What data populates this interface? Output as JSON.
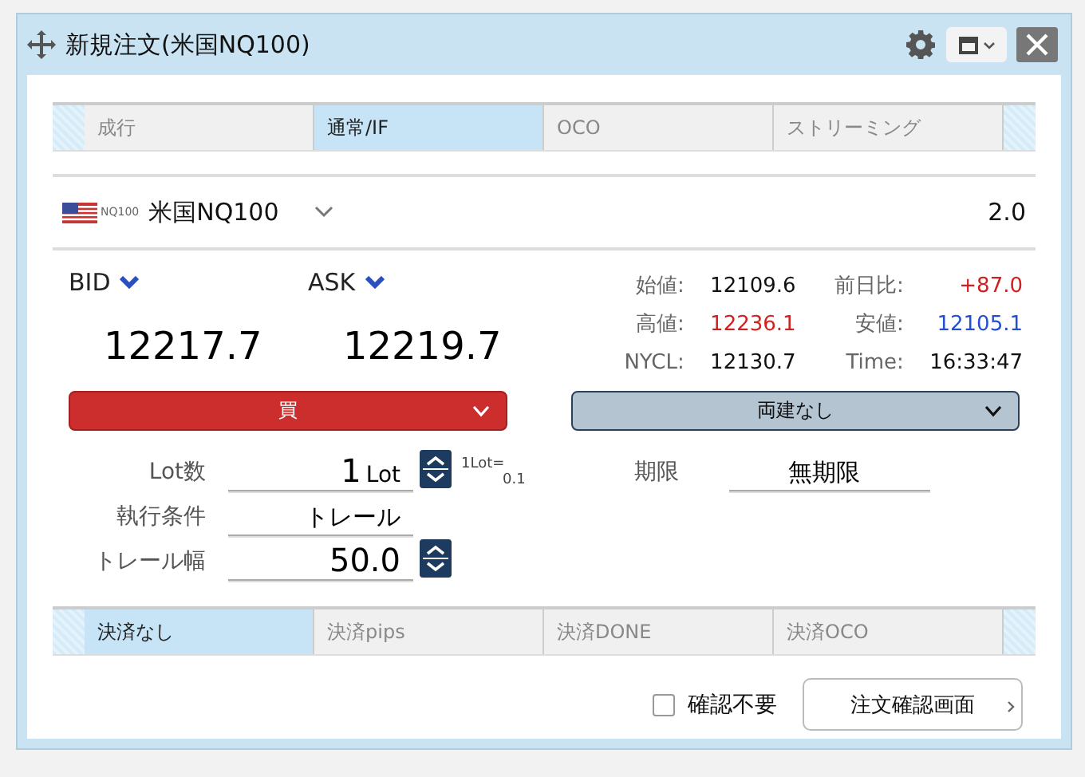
{
  "window": {
    "title": "新規注文(米国NQ100)"
  },
  "order_tabs": [
    {
      "label": "成行",
      "selected": false
    },
    {
      "label": "通常/IF",
      "selected": true
    },
    {
      "label": "OCO",
      "selected": false
    },
    {
      "label": "ストリーミング",
      "selected": false
    }
  ],
  "symbol": {
    "code": "NQ100",
    "name": "米国NQ100",
    "value": "2.0"
  },
  "bid": {
    "label": "BID",
    "price": "12217.7"
  },
  "ask": {
    "label": "ASK",
    "price": "12219.7"
  },
  "stats": [
    {
      "label": "始値:",
      "value": "12109.6",
      "color": "#111111"
    },
    {
      "label": "前日比:",
      "value": "+87.0",
      "color": "#d02020"
    },
    {
      "label": "高値:",
      "value": "12236.1",
      "color": "#d02020"
    },
    {
      "label": "安値:",
      "value": "12105.1",
      "color": "#2050d0"
    },
    {
      "label": "NYCL:",
      "value": "12130.7",
      "color": "#111111"
    },
    {
      "label": "Time:",
      "value": "16:33:47",
      "color": "#111111"
    }
  ],
  "side": {
    "value": "買"
  },
  "hedge": {
    "value": "両建なし"
  },
  "lot": {
    "label": "Lot数",
    "value": "1",
    "unit": "Lot",
    "note": "1Lot=",
    "note_value": "0.1"
  },
  "expiry": {
    "label": "期限",
    "value": "無期限"
  },
  "condition": {
    "label": "執行条件",
    "value": "トレール"
  },
  "trail": {
    "label": "トレール幅",
    "value": "50.0"
  },
  "settle_tabs": [
    {
      "label": "決済なし",
      "selected": true
    },
    {
      "label": "決済pips",
      "selected": false
    },
    {
      "label": "決済DONE",
      "selected": false
    },
    {
      "label": "決済OCO",
      "selected": false
    }
  ],
  "skip_confirm": {
    "label": "確認不要",
    "checked": false
  },
  "confirm_button": {
    "label": "注文確認画面"
  }
}
